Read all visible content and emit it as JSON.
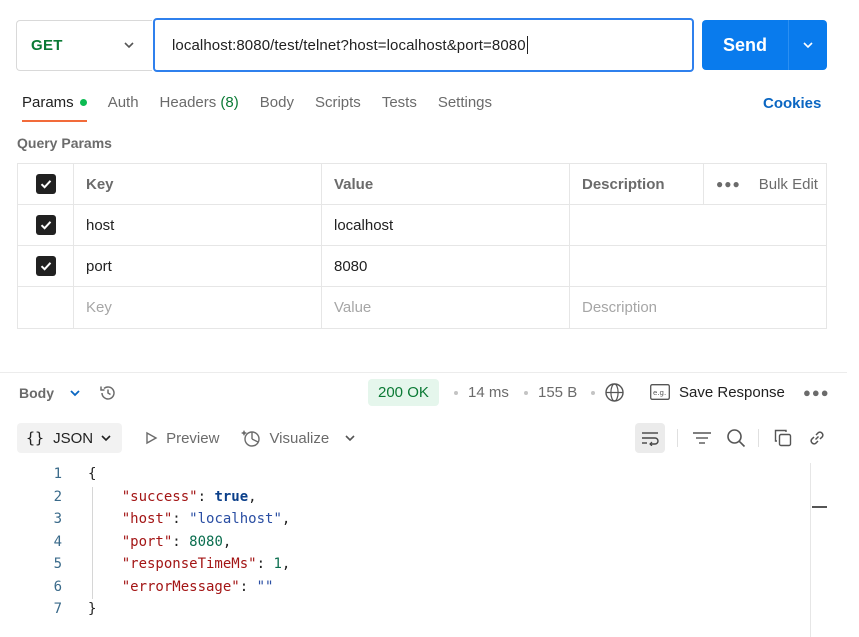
{
  "request": {
    "method": "GET",
    "url": "localhost:8080/test/telnet?host=localhost&port=8080",
    "send_label": "Send"
  },
  "tabs": [
    {
      "label": "Params",
      "active": true
    },
    {
      "label": "Auth"
    },
    {
      "label": "Headers",
      "count": "(8)"
    },
    {
      "label": "Body"
    },
    {
      "label": "Scripts"
    },
    {
      "label": "Tests"
    },
    {
      "label": "Settings"
    }
  ],
  "cookies_label": "Cookies",
  "query_params": {
    "title": "Query Params",
    "headers": {
      "key": "Key",
      "value": "Value",
      "description": "Description",
      "bulk_edit": "Bulk Edit"
    },
    "rows": [
      {
        "checked": true,
        "key": "host",
        "value": "localhost",
        "description": ""
      },
      {
        "checked": true,
        "key": "port",
        "value": "8080",
        "description": ""
      }
    ],
    "placeholders": {
      "key": "Key",
      "value": "Value",
      "description": "Description"
    }
  },
  "response": {
    "body_label": "Body",
    "status": "200 OK",
    "time": "14 ms",
    "size": "155 B",
    "save_label": "Save Response",
    "format_label": "JSON",
    "preview_label": "Preview",
    "visualize_label": "Visualize",
    "lines": [
      "1",
      "2",
      "3",
      "4",
      "5",
      "6",
      "7"
    ],
    "json": {
      "open": "{",
      "close": "}",
      "fields": [
        {
          "key": "\"success\"",
          "value": "true",
          "type": "bool"
        },
        {
          "key": "\"host\"",
          "value": "\"localhost\"",
          "type": "string"
        },
        {
          "key": "\"port\"",
          "value": "8080",
          "type": "number"
        },
        {
          "key": "\"responseTimeMs\"",
          "value": "1",
          "type": "number"
        },
        {
          "key": "\"errorMessage\"",
          "value": "\"\"",
          "type": "string"
        }
      ]
    }
  },
  "colors": {
    "accent_blue": "#097bed",
    "method_green": "#0b7a35",
    "tab_underline": "#f26b3a",
    "status_bg": "#e5f6ec"
  },
  "icons": [
    "chevron-down-icon",
    "history-icon",
    "globe-icon",
    "save-response-icon",
    "more-icon",
    "preview-play-icon",
    "visualize-icon",
    "wrap-lines-icon",
    "filter-icon",
    "search-icon",
    "copy-icon",
    "link-icon",
    "checkbox-checked-icon"
  ]
}
